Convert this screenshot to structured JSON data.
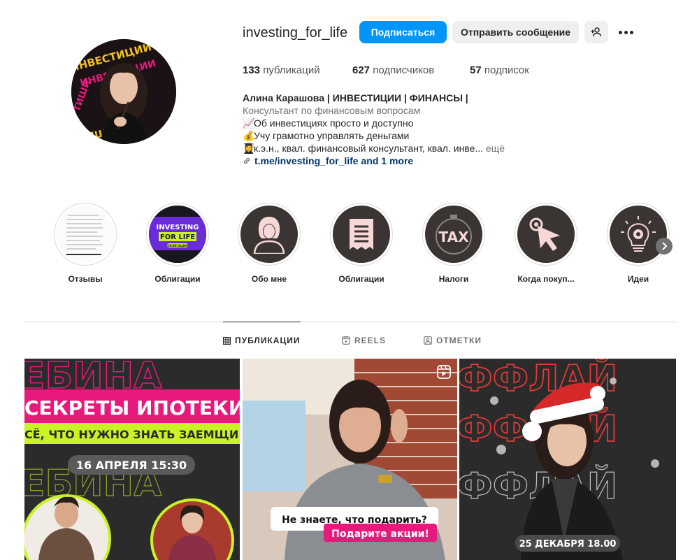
{
  "profile": {
    "username": "investing_for_life",
    "follow_label": "Подписаться",
    "message_label": "Отправить сообщение",
    "add_user_icon": "add-user-icon",
    "more_icon": "more-options-icon"
  },
  "stats": {
    "posts_count": "133",
    "posts_label": "публикаций",
    "followers_count": "627",
    "followers_label": "подписчиков",
    "following_count": "57",
    "following_label": "подписок"
  },
  "bio": {
    "name": "Алина Карашова | ИНВЕСТИЦИИ | ФИНАНСЫ |",
    "category": "Консультант по финансовым вопросам",
    "line1_emoji": "📈",
    "line1": "Об инвестициях просто и доступно",
    "line2_emoji": "💰",
    "line2": "Учу грамотно управлять деньгами",
    "line3_emoji": "👩‍🎓",
    "line3": "к.э.н., квал. финансовый консультант, квал. инве...",
    "more": " ещё",
    "link": "t.me/investing_for_life and 1 more"
  },
  "avatar": {
    "ring_text": "ИНВЕСТИЦИИ",
    "ring_text_2": "ТИШИ"
  },
  "highlights": [
    {
      "label": "Отзывы"
    },
    {
      "label": "Облигации",
      "cover_line1": "INVESTING",
      "cover_line2": "FOR LIFE",
      "cover_badge": "ОБЛИГАЦИИ"
    },
    {
      "label": "Обо мне"
    },
    {
      "label": "Облигации"
    },
    {
      "label": "Налоги",
      "cover_text": "TAX"
    },
    {
      "label": "Когда покуп..."
    },
    {
      "label": "Идеи"
    }
  ],
  "tabs": [
    {
      "label": "ПУБЛИКАЦИИ",
      "icon": "grid-icon"
    },
    {
      "label": "REELS",
      "icon": "reels-icon"
    },
    {
      "label": "ОТМЕТКИ",
      "icon": "tagged-icon"
    }
  ],
  "posts": [
    {
      "title": "СЕКРЕТЫ ИПОТЕКИ",
      "subtitle": "СЁ, ЧТО НУЖНО ЗНАТЬ ЗАЕМЩИ",
      "date": "16 АПРЕЛЯ 15:30",
      "bg_word": "ЕБИНА"
    },
    {
      "question": "Не знаете, что подарить?",
      "answer": "Подарите акции!",
      "badge_icon": "reels-icon"
    },
    {
      "date": "25 ДЕКАБРЯ 18.00",
      "bg_word": "ФФЛАЙ"
    }
  ],
  "colors": {
    "primary_button": "#0095f6",
    "secondary_button": "#efefef",
    "link": "#00376b",
    "muted": "#737373",
    "highlight_disc": "#3a3433",
    "accent_pink": "#e8197d",
    "accent_lime": "#c9f227",
    "accent_red": "#e53935"
  }
}
